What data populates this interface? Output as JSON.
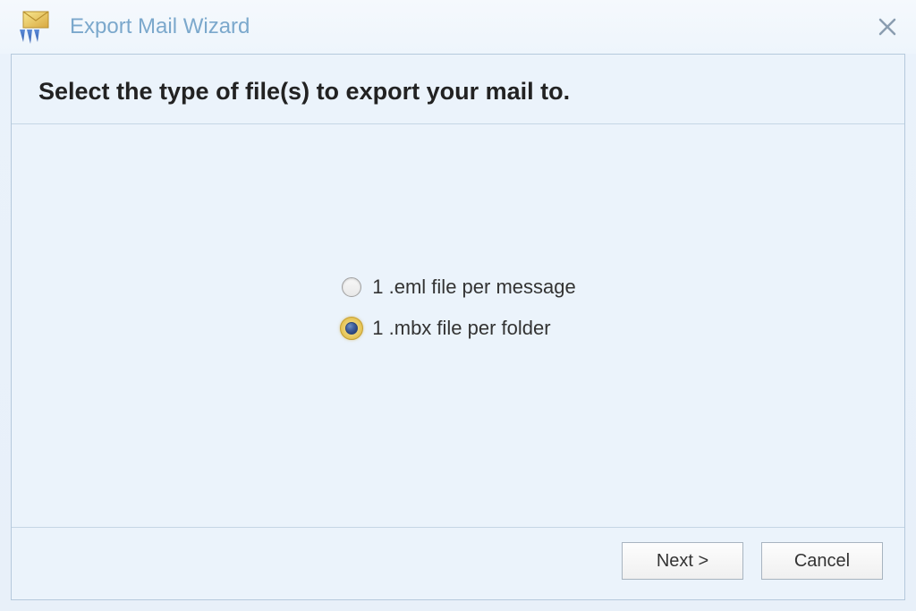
{
  "window": {
    "title": "Export Mail Wizard"
  },
  "heading": "Select the type of file(s) to export your mail to.",
  "options": {
    "eml": {
      "label": "1 .eml file per message",
      "selected": false
    },
    "mbx": {
      "label": "1 .mbx file per folder",
      "selected": true
    }
  },
  "buttons": {
    "next": "Next >",
    "cancel": "Cancel"
  }
}
